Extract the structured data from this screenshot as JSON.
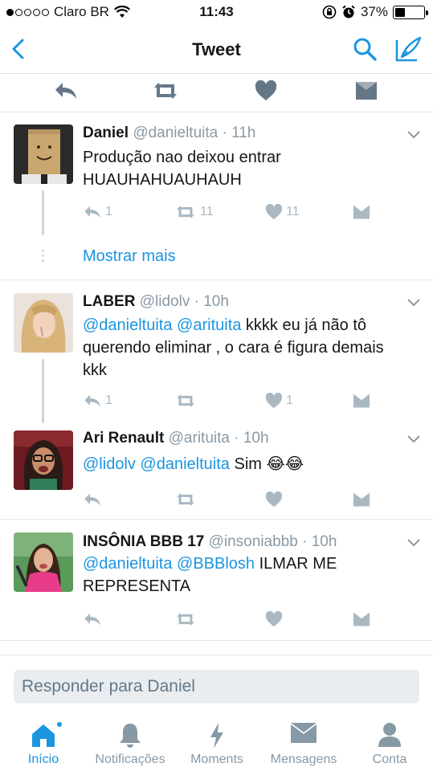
{
  "status_bar": {
    "carrier": "Claro BR",
    "time": "11:43",
    "battery_percent": "37%",
    "battery_level": 0.37,
    "signal_bars": 1
  },
  "nav": {
    "title": "Tweet",
    "icons": [
      "back-chevron-icon",
      "search-icon",
      "compose-icon"
    ]
  },
  "colors": {
    "accent": "#1b95e0",
    "muted": "#8899a6",
    "action_gray": "#aab8c2"
  },
  "tweets": [
    {
      "name": "Daniel",
      "handle": "@danieltuita",
      "time": "· 11h",
      "text": "Produção nao deixou entrar HUAUHAHUAUHAUH",
      "actions": {
        "reply": "1",
        "retweet": "11",
        "like": "11"
      }
    },
    {
      "show_more": "Mostrar mais"
    },
    {
      "name": "LABER",
      "handle": "@lidolv",
      "time": "· 10h",
      "mentions": "@danieltuita @arituita",
      "text": " kkkk eu já não tô querendo eliminar , o cara é figura demais kkk",
      "actions": {
        "reply": "1",
        "retweet": "",
        "like": "1"
      }
    },
    {
      "name": "Ari Renault",
      "handle": "@arituita",
      "time": "· 10h",
      "mentions": "@lidolv @danieltuita",
      "text": " Sim 😂😂"
    },
    {
      "name": "INSÔNIA BBB 17",
      "handle": "@insoniabbb",
      "time": "· 10h",
      "mentions": "@danieltuita @BBBlosh",
      "text": " ILMAR ME REPRESENTA"
    }
  ],
  "reply": {
    "placeholder": "Responder para Daniel"
  },
  "tabs": [
    {
      "label": "Início",
      "icon": "home-icon",
      "active": true
    },
    {
      "label": "Notificações",
      "icon": "bell-icon"
    },
    {
      "label": "Moments",
      "icon": "lightning-icon"
    },
    {
      "label": "Mensagens",
      "icon": "envelope-icon"
    },
    {
      "label": "Conta",
      "icon": "person-icon"
    }
  ]
}
